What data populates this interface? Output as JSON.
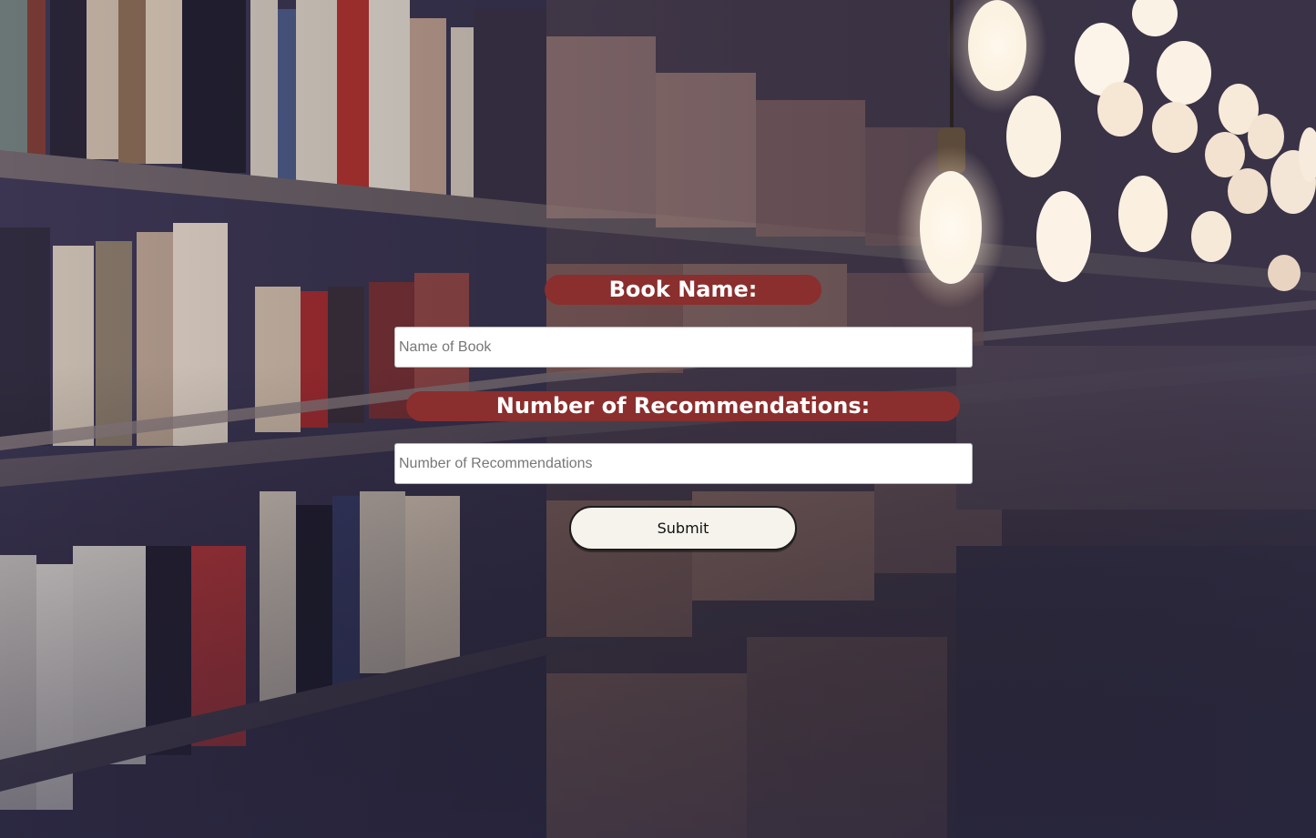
{
  "form": {
    "book_name_label": "Book Name:",
    "book_name_placeholder": "Name of Book",
    "book_name_value": "",
    "recommendations_label": "Number of Recommendations:",
    "recommendations_placeholder": "Number of Recommendations",
    "recommendations_value": "",
    "submit_label": "Submit"
  },
  "colors": {
    "label_background": "#8b2e2e",
    "label_text": "#ffffff",
    "button_background": "#f5f3ec",
    "input_background": "#ffffff"
  },
  "background": {
    "image": "library-bookshelves-with-hanging-light-bulbs"
  }
}
